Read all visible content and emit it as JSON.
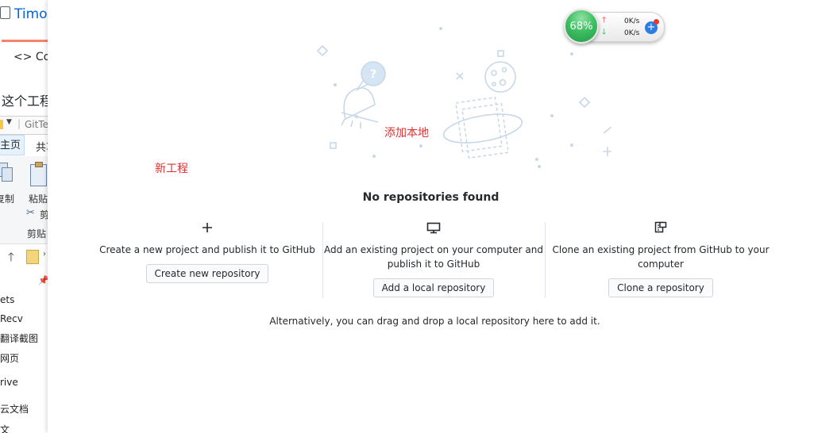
{
  "background_window": {
    "repo_title": "Timo",
    "code_tab": "Cod",
    "project_label": "这个工程",
    "address_path": "GitTe",
    "ribbon_tab_home": "主页",
    "ribbon_tab_share": "共享",
    "copy_label": "复制",
    "paste_label": "粘贴",
    "cut_label": "剪",
    "clipboard_label": "剪贴",
    "nav_items": [
      "ets",
      "Recv",
      "翻译截图",
      "网页",
      "rive",
      "云文档",
      "文"
    ]
  },
  "main": {
    "empty_title": "No repositories found",
    "actions": [
      {
        "icon": "plus-icon",
        "description": "Create a new project and publish it to GitHub",
        "button": "Create new repository"
      },
      {
        "icon": "desktop-icon",
        "description": "Add an existing project on your computer and publish it to GitHub",
        "button": "Add a local repository"
      },
      {
        "icon": "repo-clone-icon",
        "description": "Clone an existing project from GitHub to your computer",
        "button": "Clone a repository"
      }
    ],
    "alternative_text": "Alternatively, you can drag and drop a local repository here to add it."
  },
  "annotations": {
    "new_project": "新工程",
    "add_local": "添加本地"
  },
  "speed_widget": {
    "percent": "68%",
    "upload": "0K/s",
    "download": "0K/s",
    "add_symbol": "+"
  },
  "colors": {
    "link_blue": "#0366d6",
    "annotation_red": "#d33333",
    "widget_green": "#3fbf63",
    "illustration_blue": "#c8d8e8",
    "tab_underline": "#f9826c"
  }
}
